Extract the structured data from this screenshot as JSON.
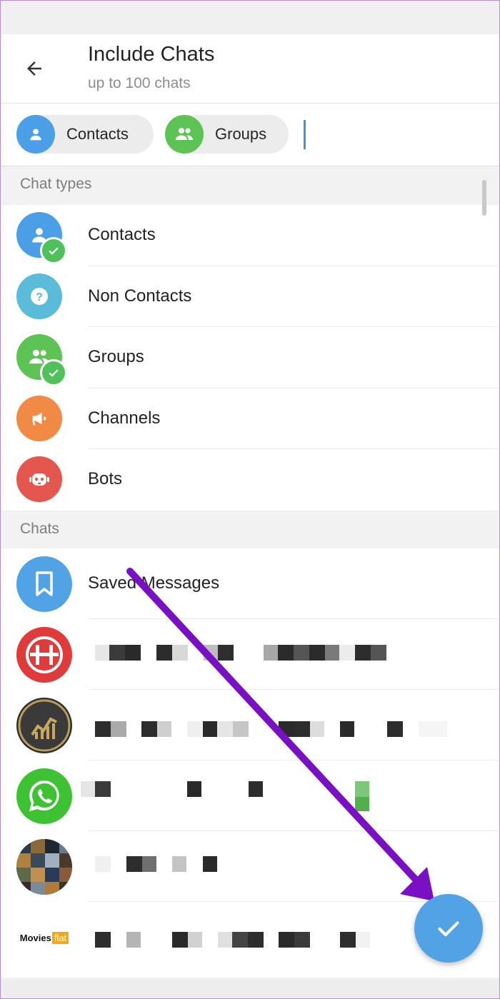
{
  "header": {
    "title": "Include Chats",
    "subtitle": "up to 100 chats",
    "back_icon": "arrow-left-icon"
  },
  "chips": [
    {
      "label": "Contacts",
      "icon": "person-icon",
      "color": "#4a9fe6"
    },
    {
      "label": "Groups",
      "icon": "group-icon",
      "color": "#5cc354"
    }
  ],
  "sections": {
    "chat_types": "Chat types",
    "chats": "Chats"
  },
  "chat_types": [
    {
      "label": "Contacts",
      "icon": "person-icon",
      "color": "#4a9fe6",
      "selected": true
    },
    {
      "label": "Non Contacts",
      "icon": "question-icon",
      "color": "#5bbcd9",
      "selected": false
    },
    {
      "label": "Groups",
      "icon": "group-icon",
      "color": "#5cc354",
      "selected": true
    },
    {
      "label": "Channels",
      "icon": "megaphone-icon",
      "color": "#f08a45",
      "selected": false
    },
    {
      "label": "Bots",
      "icon": "bot-icon",
      "color": "#e3574f",
      "selected": false
    }
  ],
  "chats": [
    {
      "label": "Saved Messages",
      "icon": "bookmark-icon",
      "color": "#52a3e6"
    },
    {
      "label": "",
      "icon": "h-logo-icon",
      "color": "#e03b3b"
    },
    {
      "label": "",
      "icon": "bull-logo-icon",
      "color": "#2e2e2e"
    },
    {
      "label": "",
      "icon": "whatsapp-icon",
      "color": "#3ec233"
    },
    {
      "label": "",
      "icon": "movie-collage-icon",
      "color": "#55606a"
    },
    {
      "label": "",
      "icon": "moviesflat-logo-icon",
      "color": "#ffffff",
      "logo_text": "Movies",
      "logo_badge": "flat"
    }
  ],
  "fab": {
    "icon": "check-icon",
    "color": "#52a3e6"
  },
  "annotation_arrow_color": "#7a10c4"
}
